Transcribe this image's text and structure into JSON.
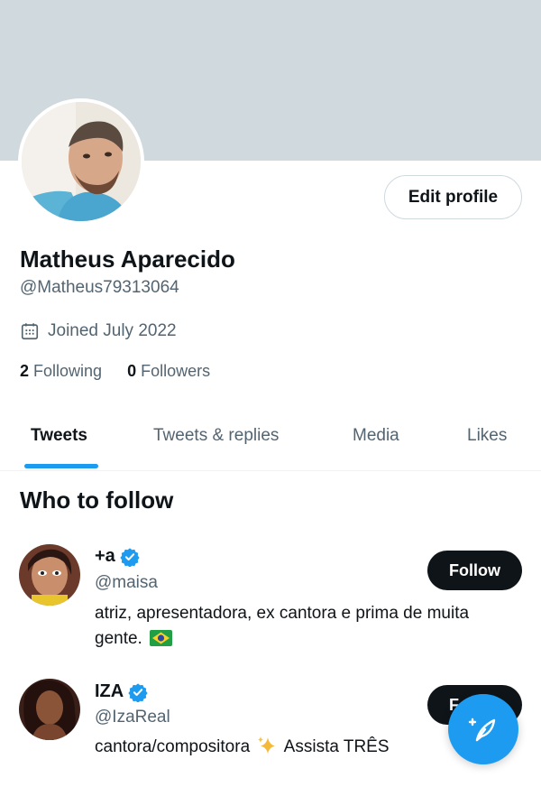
{
  "profile": {
    "name": "Matheus Aparecido",
    "handle": "@Matheus79313064",
    "joined": "Joined July 2022",
    "edit_label": "Edit profile",
    "following_count": "2",
    "following_label": "Following",
    "followers_count": "0",
    "followers_label": "Followers"
  },
  "tabs": [
    "Tweets",
    "Tweets & replies",
    "Media",
    "Likes"
  ],
  "who_to_follow": {
    "title": "Who to follow",
    "users": [
      {
        "name": "+a",
        "handle": "@maisa",
        "bio": "atriz, apresentadora, ex cantora e prima de muita gente.",
        "follow_label": "Follow",
        "verified": true
      },
      {
        "name": "IZA",
        "handle": "@IzaReal",
        "bio_before": "cantora/compositora",
        "bio_after": "Assista TRÊS",
        "follow_label": "Follow",
        "verified": true
      }
    ]
  },
  "icons": {
    "calendar": "calendar-icon",
    "verified": "verified-badge-icon",
    "compose": "compose-tweet-icon"
  },
  "colors": {
    "accent": "#1d9bf0",
    "banner": "#cfd9de",
    "text": "#0f1419",
    "secondary": "#536471"
  }
}
